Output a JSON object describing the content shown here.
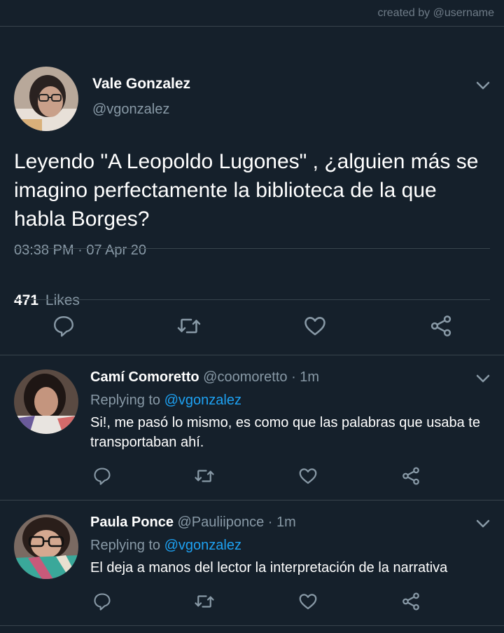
{
  "credit": "created by @username",
  "main_tweet": {
    "name": "Vale Gonzalez",
    "handle": "@vgonzalez",
    "text": "Leyendo \"A Leopoldo Lugones\" , ¿alguien más se imagino perfectamente la biblioteca de la que habla Borges?",
    "timestamp": "03:38 PM · 07 Apr 20",
    "likes_count": "471",
    "likes_label": "Likes",
    "avatar_icon": "profile-photo-woman-glasses"
  },
  "replies": [
    {
      "name": "Camí Comoretto",
      "handle": "@coomoretto",
      "time": "· 1m",
      "replying_prefix": "Replying to",
      "replying_to": "@vgonzalez",
      "text": "Si!, me pasó lo mismo, es como que las palabras que usaba te transportaban ahí.",
      "avatar_icon": "profile-photo-woman"
    },
    {
      "name": "Paula Ponce",
      "handle": "@Pauliiponce",
      "time": "· 1m",
      "replying_prefix": "Replying to",
      "replying_to": "@vgonzalez",
      "text": "El deja a manos del lector la interpretación de la narrativa",
      "avatar_icon": "profile-photo-woman-glasses-scarf"
    }
  ],
  "colors": {
    "background": "#15202b",
    "divider": "#38444d",
    "secondary_text": "#8899a6",
    "link": "#1da1f2"
  },
  "icons": [
    "chevron-down-icon",
    "reply-icon",
    "retweet-icon",
    "like-icon",
    "share-icon"
  ]
}
